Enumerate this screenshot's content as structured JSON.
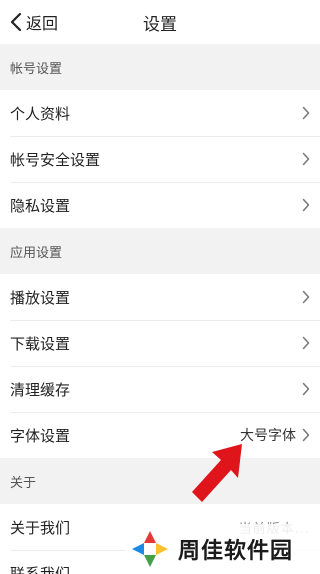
{
  "nav": {
    "back_label": "返回",
    "title": "设置"
  },
  "sections": [
    {
      "header": "帐号设置",
      "rows": [
        {
          "label": "个人资料",
          "value": ""
        },
        {
          "label": "帐号安全设置",
          "value": ""
        },
        {
          "label": "隐私设置",
          "value": ""
        }
      ]
    },
    {
      "header": "应用设置",
      "rows": [
        {
          "label": "播放设置",
          "value": ""
        },
        {
          "label": "下载设置",
          "value": ""
        },
        {
          "label": "清理缓存",
          "value": ""
        },
        {
          "label": "字体设置",
          "value": "大号字体"
        }
      ]
    },
    {
      "header": "关于",
      "rows": [
        {
          "label": "关于我们",
          "value": "当前版本..."
        },
        {
          "label": "联系我们",
          "value": ""
        }
      ]
    }
  ],
  "watermark": {
    "text": "周佳软件园"
  },
  "colors": {
    "arrow": "#e0141b",
    "background": "#f5f5f5"
  }
}
